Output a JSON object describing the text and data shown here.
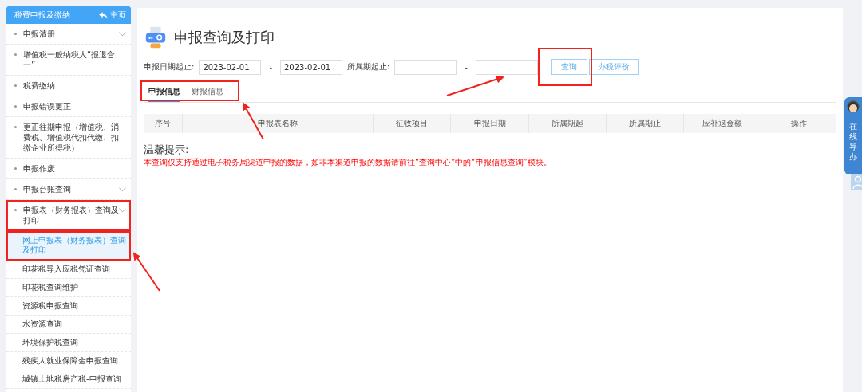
{
  "sidebar": {
    "title": "税费申报及缴纳",
    "home_link": "主页",
    "items": [
      {
        "label": "申报清册",
        "expandable": true,
        "expanded": false
      },
      {
        "label": "增值税一般纳税人“报退合一”",
        "expandable": false,
        "expanded": false
      },
      {
        "label": "税费缴纳",
        "expandable": false,
        "expanded": false
      },
      {
        "label": "申报错误更正",
        "expandable": false,
        "expanded": false
      },
      {
        "label": "更正往期申报（增值税、消费税、增值税代扣代缴、扣缴企业所得税）",
        "expandable": false,
        "expanded": false
      },
      {
        "label": "申报作废",
        "expandable": false,
        "expanded": false
      },
      {
        "label": "申报台账查询",
        "expandable": true,
        "expanded": false
      },
      {
        "label": "申报表（财务报表）查询及打印",
        "expandable": true,
        "expanded": true,
        "children": [
          {
            "label": "网上申报表（财务报表）查询及打印",
            "selected": true
          },
          {
            "label": "印花税导入应税凭证查询",
            "selected": false
          },
          {
            "label": "印花税查询维护",
            "selected": false
          },
          {
            "label": "资源税申报查询",
            "selected": false
          },
          {
            "label": "水资源查询",
            "selected": false
          },
          {
            "label": "环境保护税查询",
            "selected": false
          },
          {
            "label": "残疾人就业保障金申报查询",
            "selected": false
          },
          {
            "label": "城镇土地税房产税-申报查询",
            "selected": false
          }
        ]
      }
    ]
  },
  "page": {
    "title": "申报查询及打印"
  },
  "filters": {
    "date_label": "申报日期起止:",
    "date_from": "2023-02-01",
    "date_sep": "-",
    "date_to": "2023-02-01",
    "period_label": "所属期起止:",
    "period_sep": "-"
  },
  "buttons": [
    {
      "label": "查询"
    },
    {
      "label": "办税评价"
    }
  ],
  "tabs": [
    {
      "label": "申报信息",
      "selected": true
    },
    {
      "label": "财报信息",
      "selected": false
    }
  ],
  "table": {
    "columns": [
      "序号",
      "申报表名称",
      "征收项目",
      "申报日期",
      "所属期起",
      "所属期止",
      "应补退金额",
      "操作"
    ]
  },
  "notice": {
    "title": "温馨提示:",
    "text": "本查询仅支持通过电子税务局渠道申报的数据，如非本渠道申报的数据请前往“查询中心”中的“申报信息查询”模块。"
  },
  "float_widget": {
    "label": "在线导办"
  }
}
